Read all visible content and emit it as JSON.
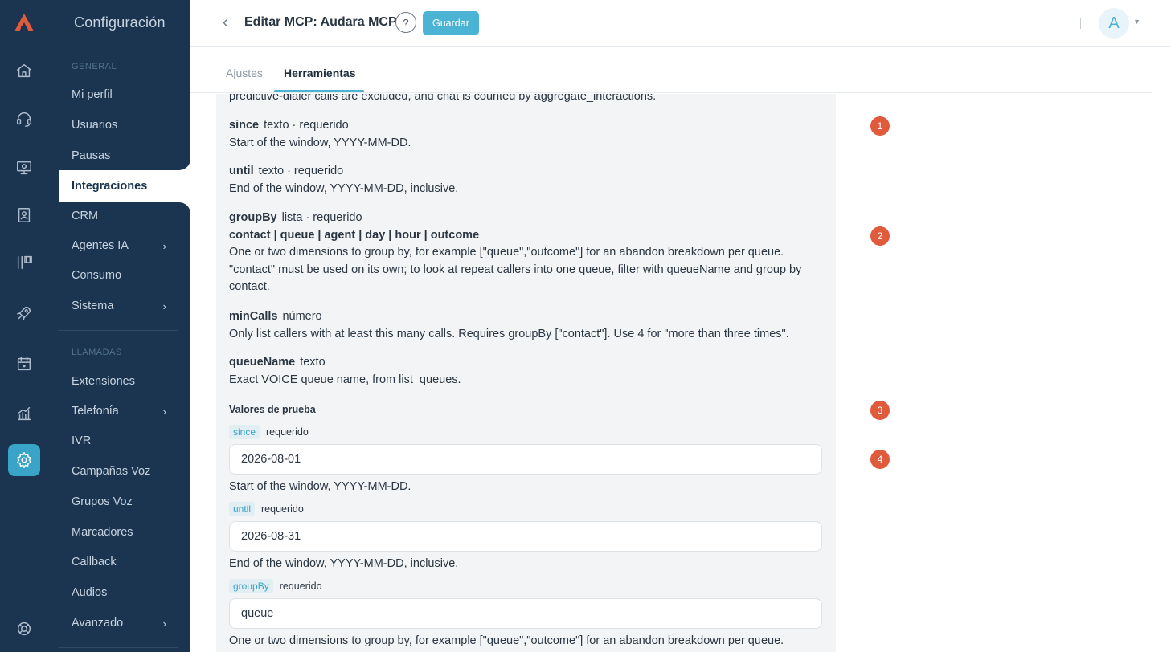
{
  "colors": {
    "sidebar_bg": "#1b3550",
    "accent": "#4bb3d3",
    "marker": "#e05a3c"
  },
  "rail": {
    "logo": "brand-logo",
    "icons": [
      "home-icon",
      "headset-icon",
      "monitor-icon",
      "contacts-icon",
      "queues-icon",
      "rocket-icon",
      "calendar-icon",
      "chart-icon",
      "settings-icon",
      "lifebuoy-icon"
    ],
    "active": "settings-icon"
  },
  "sidebar": {
    "title": "Configuración",
    "section_general": "GENERAL",
    "section_calls": "LLAMADAS",
    "items": {
      "mi_perfil": "Mi perfil",
      "usuarios": "Usuarios",
      "pausas": "Pausas",
      "integraciones": "Integraciones",
      "crm": "CRM",
      "agentes_ia": "Agentes IA",
      "consumo": "Consumo",
      "sistema": "Sistema",
      "extensiones": "Extensiones",
      "telefonia": "Telefonía",
      "ivr": "IVR",
      "campanas_voz": "Campañas Voz",
      "grupos_voz": "Grupos Voz",
      "marcadores": "Marcadores",
      "callback": "Callback",
      "audios": "Audios",
      "avanzado": "Avanzado"
    },
    "active": "Integraciones"
  },
  "header": {
    "title": "Editar MCP: Audara MCP",
    "help": "?",
    "save": "Guardar",
    "avatar": "A"
  },
  "tabs": {
    "settings": "Ajustes",
    "tools": "Herramientas",
    "active": "Herramientas"
  },
  "tool": {
    "intro": "predictive-dialer calls are excluded, and chat is counted by aggregate_interactions.",
    "params": {
      "since": {
        "name": "since",
        "type": "texto · requerido",
        "desc": "Start of the window, YYYY-MM-DD."
      },
      "until": {
        "name": "until",
        "type": "texto · requerido",
        "desc": "End of the window, YYYY-MM-DD, inclusive."
      },
      "groupBy": {
        "name": "groupBy",
        "type": "lista · requerido",
        "options": "contact | queue | agent | day | hour | outcome",
        "desc1": "One or two dimensions to group by, for example [\"queue\",\"outcome\"] for an abandon breakdown per queue.",
        "desc2": "\"contact\" must be used on its own; to look at repeat callers into one queue, filter with queueName and group by",
        "desc3": "contact."
      },
      "minCalls": {
        "name": "minCalls",
        "type": "número",
        "desc": "Only list callers with at least this many calls. Requires groupBy [\"contact\"]. Use 4 for \"more than three times\"."
      },
      "queueName": {
        "name": "queueName",
        "type": "texto",
        "desc": "Exact VOICE queue name, from list_queues."
      }
    },
    "test": {
      "heading": "Valores de prueba",
      "required": "requerido",
      "since": {
        "tag": "since",
        "value": "2026-08-01",
        "hint": "Start of the window, YYYY-MM-DD."
      },
      "until": {
        "tag": "until",
        "value": "2026-08-31",
        "hint": "End of the window, YYYY-MM-DD, inclusive."
      },
      "groupBy": {
        "tag": "groupBy",
        "value": "queue",
        "hint": "One or two dimensions to group by, for example [\"queue\",\"outcome\"] for an abandon breakdown per queue."
      }
    }
  },
  "markers": [
    "1",
    "2",
    "3",
    "4"
  ]
}
